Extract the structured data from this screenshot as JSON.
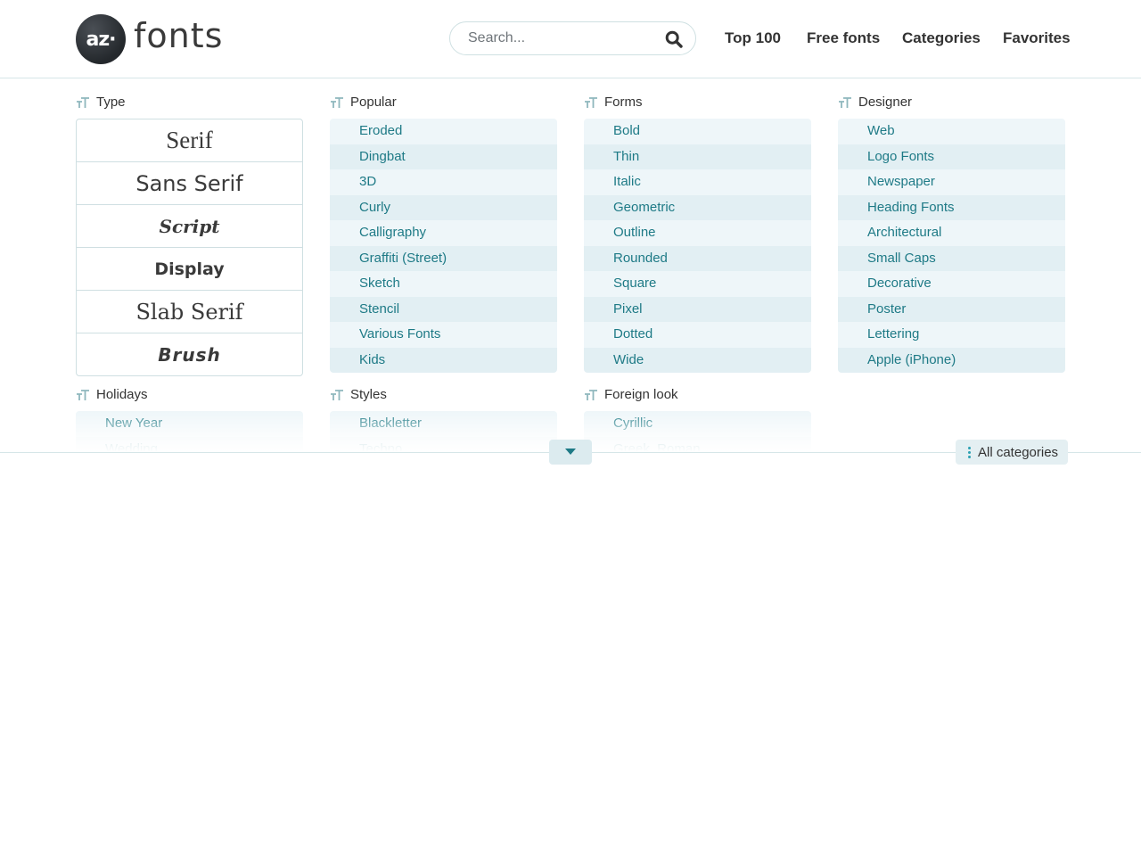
{
  "logo": {
    "badge": "az·",
    "text": "fonts"
  },
  "search": {
    "placeholder": "Search..."
  },
  "nav": [
    {
      "label": "Top 100"
    },
    {
      "label": "Free fonts"
    },
    {
      "label": "Categories"
    },
    {
      "label": "Favorites"
    }
  ],
  "columns": {
    "type": {
      "title": "Type",
      "items": [
        "Serif",
        "Sans Serif",
        "Script",
        "Display",
        "Slab Serif",
        "Brush"
      ]
    },
    "popular": {
      "title": "Popular",
      "items": [
        "Eroded",
        "Dingbat",
        "3D",
        "Curly",
        "Calligraphy",
        "Graffiti (Street)",
        "Sketch",
        "Stencil",
        "Various Fonts",
        "Kids"
      ]
    },
    "forms": {
      "title": "Forms",
      "items": [
        "Bold",
        "Thin",
        "Italic",
        "Geometric",
        "Outline",
        "Rounded",
        "Square",
        "Pixel",
        "Dotted",
        "Wide"
      ]
    },
    "designer": {
      "title": "Designer",
      "items": [
        "Web",
        "Logo Fonts",
        "Newspaper",
        "Heading Fonts",
        "Architectural",
        "Small Caps",
        "Decorative",
        "Poster",
        "Lettering",
        "Apple (iPhone)"
      ]
    },
    "holidays": {
      "title": "Holidays",
      "items": [
        "New Year",
        "Wedding"
      ]
    },
    "styles": {
      "title": "Styles",
      "items": [
        "Blackletter",
        "Techno"
      ]
    },
    "foreign": {
      "title": "Foreign look",
      "items": [
        "Cyrillic",
        "Greek, Roman"
      ]
    }
  },
  "buttons": {
    "expand_icon": "chevron-down-icon",
    "all_categories": "All categories"
  },
  "colors": {
    "link": "#1e7a86",
    "row_light": "#eef6f9",
    "row_dark": "#e2eff3",
    "border": "#d6e6e8"
  }
}
